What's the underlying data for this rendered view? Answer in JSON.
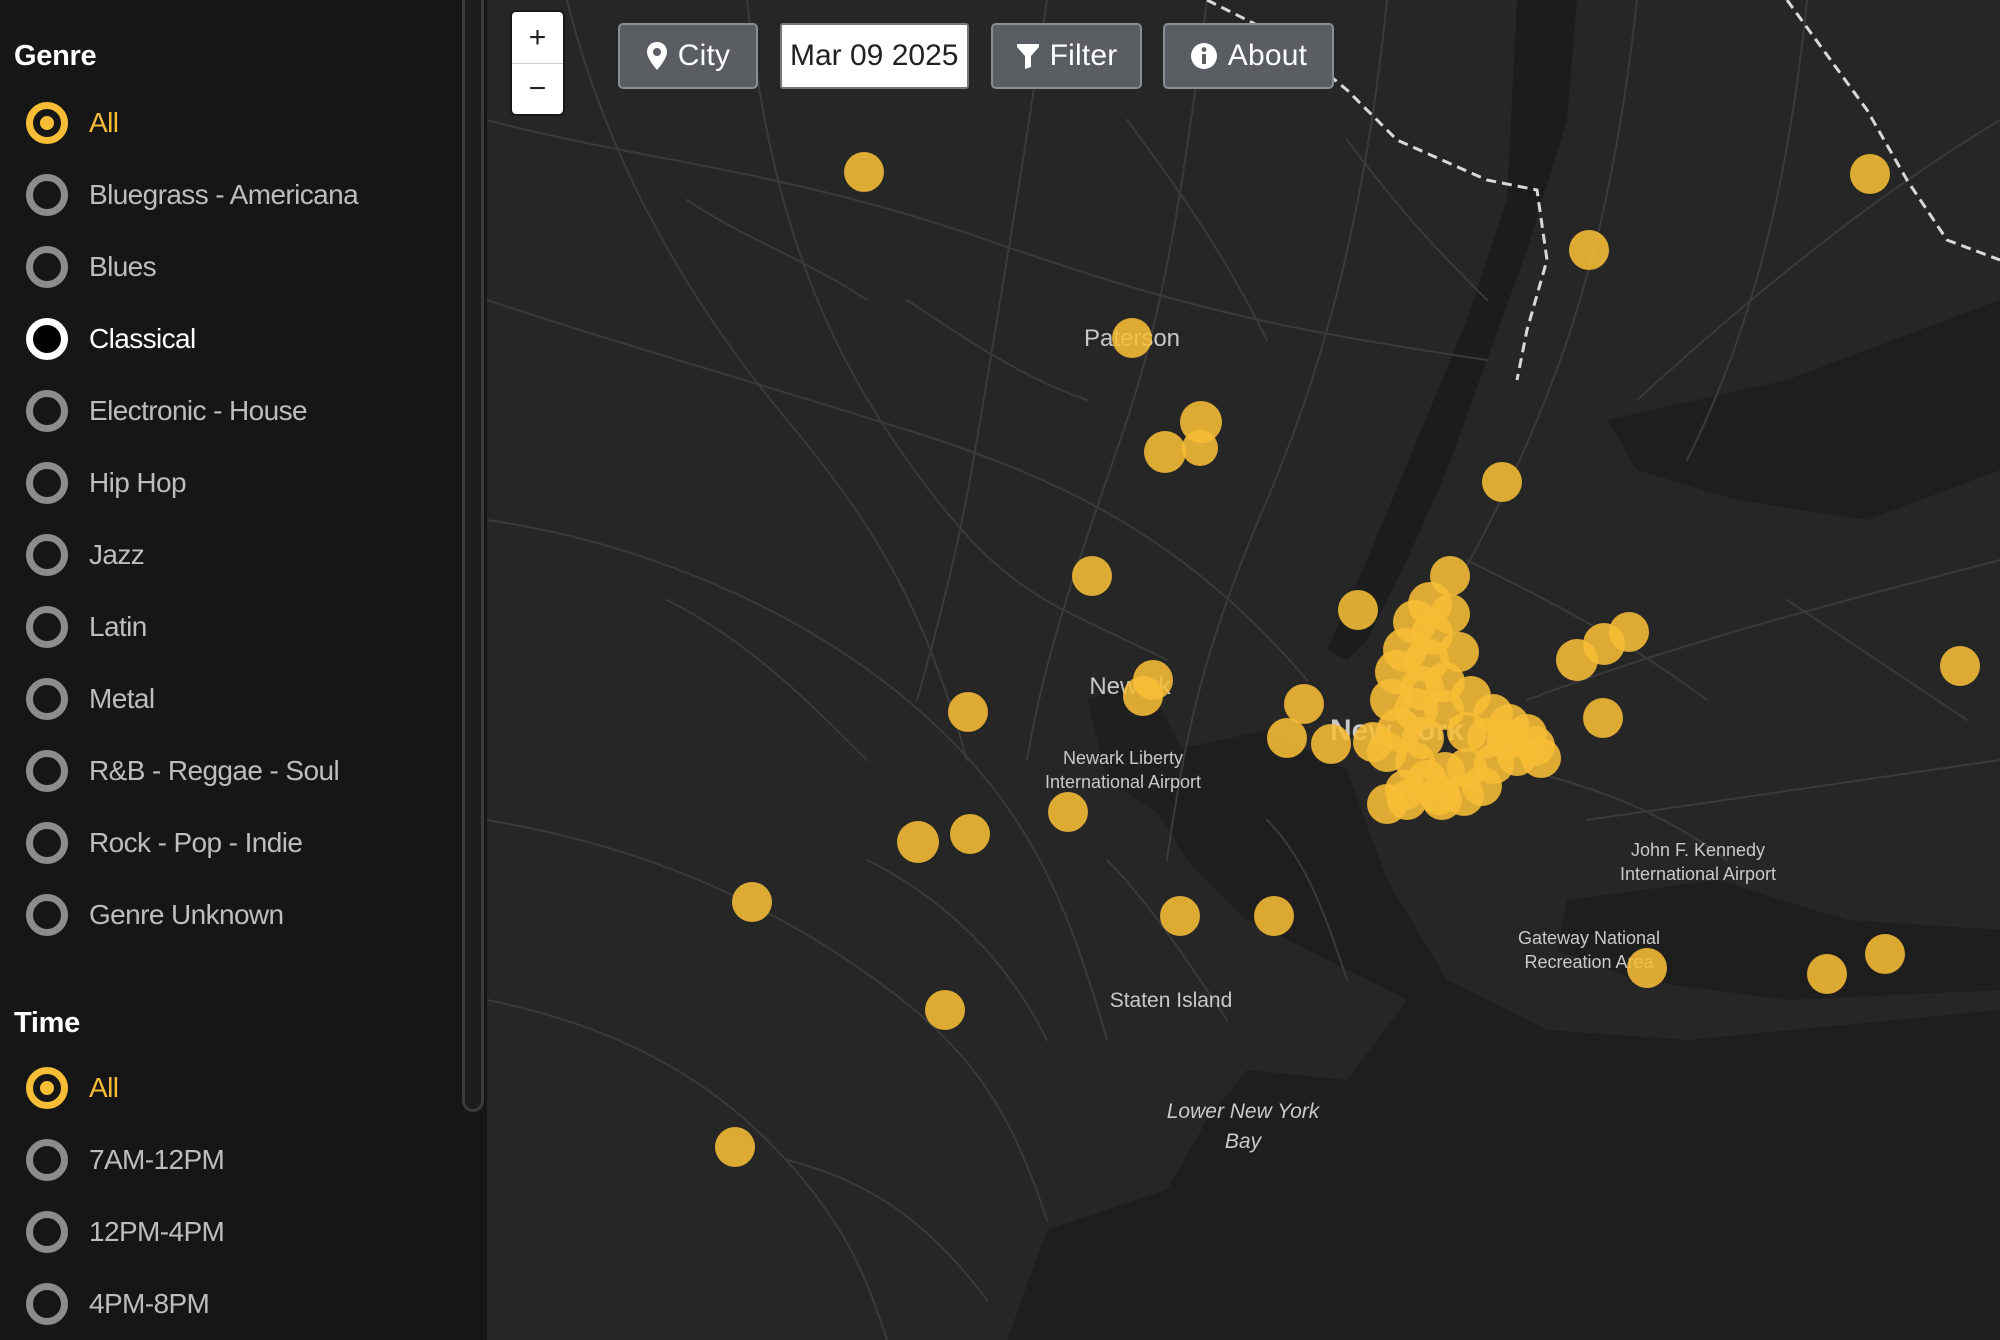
{
  "sidebar": {
    "genre_title": "Genre",
    "genres": [
      {
        "label": "All",
        "state": "selected"
      },
      {
        "label": "Bluegrass - Americana",
        "state": "default"
      },
      {
        "label": "Blues",
        "state": "default"
      },
      {
        "label": "Classical",
        "state": "hover"
      },
      {
        "label": "Electronic - House",
        "state": "default"
      },
      {
        "label": "Hip Hop",
        "state": "default"
      },
      {
        "label": "Jazz",
        "state": "default"
      },
      {
        "label": "Latin",
        "state": "default"
      },
      {
        "label": "Metal",
        "state": "default"
      },
      {
        "label": "R&B - Reggae - Soul",
        "state": "default"
      },
      {
        "label": "Rock - Pop - Indie",
        "state": "default"
      },
      {
        "label": "Genre Unknown",
        "state": "default"
      }
    ],
    "time_title": "Time",
    "times": [
      {
        "label": "All",
        "state": "selected"
      },
      {
        "label": "7AM-12PM",
        "state": "default"
      },
      {
        "label": "12PM-4PM",
        "state": "default"
      },
      {
        "label": "4PM-8PM",
        "state": "default"
      }
    ]
  },
  "toolbar": {
    "zoom_in": "+",
    "zoom_out": "−",
    "city_label": "City",
    "city_icon": "map-pin-icon",
    "date_value": "Mar 09 2025",
    "filter_label": "Filter",
    "filter_icon": "funnel-icon",
    "about_label": "About",
    "about_icon": "info-icon"
  },
  "map": {
    "labels": {
      "paterson": "Paterson",
      "newark": "Newark",
      "newark_airport_1": "Newark Liberty",
      "newark_airport_2": "International Airport",
      "new_york": "New York",
      "jfk_1": "John F. Kennedy",
      "jfk_2": "International Airport",
      "gateway_1": "Gateway National",
      "gateway_2": "Recreation Area",
      "staten_island": "Staten Island",
      "bay_1": "Lower New York",
      "bay_2": "Bay"
    },
    "colors": {
      "event_marker": "#f7bd36",
      "accent": "#f7bd36",
      "land": "#262626",
      "water": "#1c1c1c"
    }
  }
}
